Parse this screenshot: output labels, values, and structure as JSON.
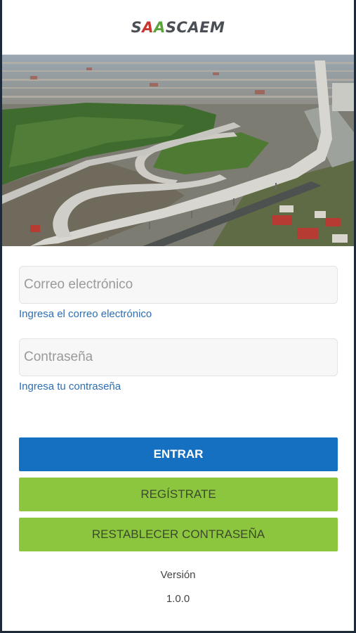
{
  "header": {
    "logo_text_part1": "S",
    "logo_text_a1": "A",
    "logo_text_a2": "A",
    "logo_text_part2": "SCAEM"
  },
  "hero": {
    "icon": "highway-interchange-photo"
  },
  "form": {
    "email": {
      "placeholder": "Correo electrónico",
      "value": "",
      "hint": "Ingresa el correo electrónico"
    },
    "password": {
      "placeholder": "Contraseña",
      "value": "",
      "hint": "Ingresa tu contraseña"
    }
  },
  "buttons": {
    "login": "ENTRAR",
    "register": "REGÍSTRATE",
    "reset": "RESTABLECER CONTRASEÑA"
  },
  "footer": {
    "version_label": "Versión",
    "version_number": "1.0.0"
  },
  "colors": {
    "primary": "#1570c2",
    "green": "#8cc63f",
    "hint_blue": "#2c6fb5",
    "logo_red": "#c8362e",
    "logo_green": "#5aa33c"
  }
}
